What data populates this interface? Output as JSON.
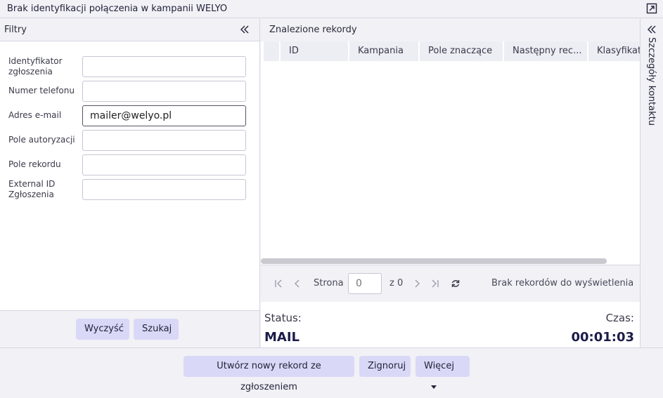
{
  "window": {
    "title": "Brak identyfikacji połączenia w kampanii WELYO"
  },
  "filters": {
    "title": "Filtry",
    "fields": [
      {
        "label": "Identyfikator zgłoszenia",
        "value": ""
      },
      {
        "label": "Numer telefonu",
        "value": ""
      },
      {
        "label": "Adres e-mail",
        "value": "mailer@welyo.pl"
      },
      {
        "label": "Pole autoryzacji",
        "value": ""
      },
      {
        "label": "Pole rekordu",
        "value": ""
      },
      {
        "label": "External ID Zgłoszenia",
        "value": ""
      }
    ],
    "clear_label": "Wyczyść",
    "search_label": "Szukaj"
  },
  "records": {
    "title": "Znalezione rekordy",
    "columns": [
      "ID",
      "Kampania",
      "Pole znaczące",
      "Następny rec...",
      "Klasyfikat"
    ],
    "pager": {
      "page_label": "Strona",
      "page_placeholder": "0",
      "of_label": "z 0",
      "empty_message": "Brak rekordów do wyświetlenia"
    }
  },
  "status": {
    "status_label": "Status:",
    "status_value": "MAIL",
    "time_label": "Czas:",
    "time_value": "00:01:03"
  },
  "side_panel": {
    "label": "Szczegóły kontaktu"
  },
  "actions": {
    "create_label": "Utwórz nowy rekord ze zgłoszeniem",
    "ignore_label": "Zignoruj",
    "more_label": "Więcej"
  }
}
